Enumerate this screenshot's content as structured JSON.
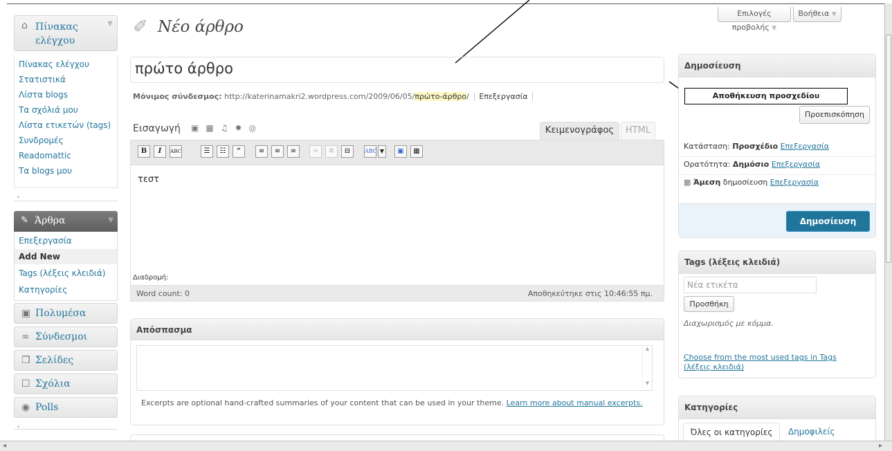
{
  "screen_options": "Επιλογές προβολής",
  "help": "Βοήθεια",
  "menu": {
    "dashboard": "Πίνακας ελέγχου",
    "dashboard_items": [
      "Πίνακας ελέγχου",
      "Στατιστικά",
      "Λίστα blogs",
      "Τα σχόλιά μου",
      "Λίστα ετικετών (tags)",
      "Συνδρομές",
      "Readomattic",
      "Τα blogs μου"
    ],
    "posts": "Άρθρα",
    "posts_items": [
      "Επεξεργασία",
      "Add New",
      "Tags (λέξεις κλειδιά)",
      "Κατηγορίες"
    ],
    "media": "Πολυμέσα",
    "links": "Σύνδεσμοι",
    "pages": "Σελίδες",
    "comments": "Σχόλια",
    "polls": "Polls"
  },
  "page_title": "Νέο άρθρο",
  "post_title": "πρώτο άρθρο",
  "permalink": {
    "label": "Μόνιμος σύνδεσμος:",
    "url_prefix": "http://katerinamakri2.wordpress.com/2009/06/05/",
    "slug": "πρώτο-άρθρο",
    "url_suffix": "/",
    "edit": "Επεξεργασία"
  },
  "editor": {
    "insert": "Εισαγωγή",
    "tab_visual": "Κειμενογράφος",
    "tab_html": "HTML",
    "content": "τεστ",
    "path": "Διαδρομή:",
    "word_count": "Word count: 0",
    "saved": "Αποθηκεύτηκε στις 10:46:55 πμ."
  },
  "excerpt": {
    "title": "Απόσπασμα",
    "help_text": "Excerpts are optional hand-crafted summaries of your content that can be used in your theme.",
    "learn_more": "Learn more about manual excerpts."
  },
  "publish": {
    "title": "Δημοσίευση",
    "save_draft": "Αποθήκευση προσχεδίου",
    "preview": "Προεπισκόπηση",
    "status_label": "Κατάσταση:",
    "status_value": "Προσχέδιο",
    "visibility_label": "Ορατότητα:",
    "visibility_value": "Δημόσιο",
    "schedule_bold": "Άμεση",
    "schedule_rest": "δημοσίευση",
    "edit": "Επεξεργασία",
    "publish_button": "Δημοσίευση"
  },
  "tags": {
    "title": "Tags (λέξεις κλειδιά)",
    "placeholder": "Νέα ετικέτα",
    "add": "Προσθήκη",
    "hint": "Διαχωρισμός με κόμμα.",
    "choose": "Choose from the most used tags in Tags (λέξεις κλειδιά)"
  },
  "categories": {
    "title": "Κατηγορίες",
    "tab_all": "Όλες οι κατηγορίες",
    "tab_popular": "Δημοφιλείς"
  },
  "colors": {
    "accent": "#21759b",
    "publish_button": "#21759b",
    "slug_highlight": "#fff8c4"
  }
}
